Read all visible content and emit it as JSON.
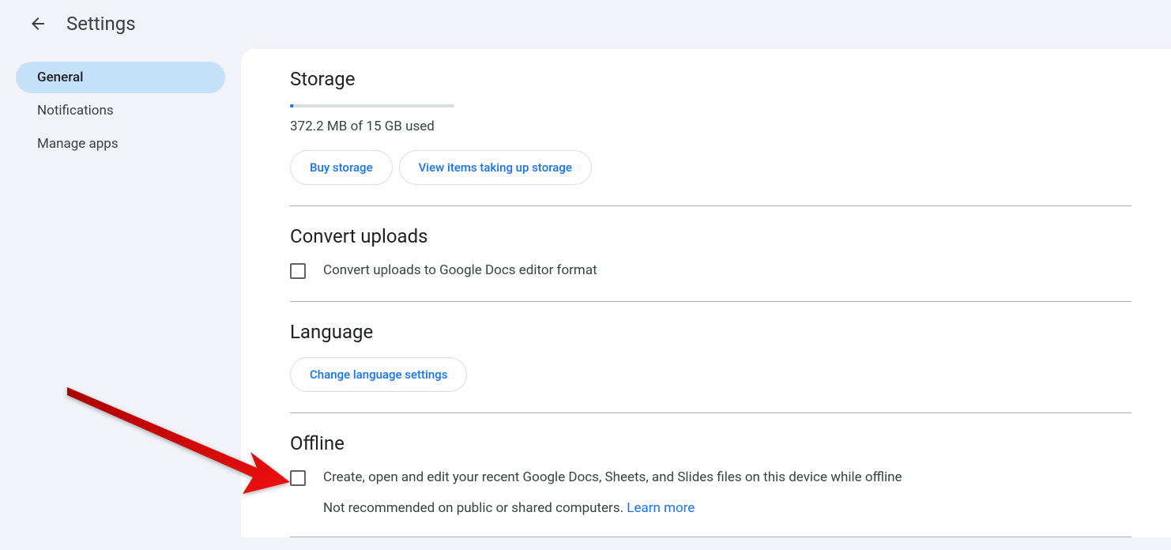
{
  "header": {
    "title": "Settings"
  },
  "sidebar": {
    "items": [
      {
        "label": "General",
        "active": true
      },
      {
        "label": "Notifications",
        "active": false
      },
      {
        "label": "Manage apps",
        "active": false
      }
    ]
  },
  "storage": {
    "title": "Storage",
    "usage_text": "372.2 MB of 15 GB used",
    "buy_btn": "Buy storage",
    "view_btn": "View items taking up storage"
  },
  "convert": {
    "title": "Convert uploads",
    "checkbox_label": "Convert uploads to Google Docs editor format"
  },
  "language": {
    "title": "Language",
    "change_btn": "Change language settings"
  },
  "offline": {
    "title": "Offline",
    "checkbox_label": "Create, open and edit your recent Google Docs, Sheets, and Slides files on this device while offline",
    "sub_text": "Not recommended on public or shared computers. ",
    "learn_more": "Learn more"
  }
}
